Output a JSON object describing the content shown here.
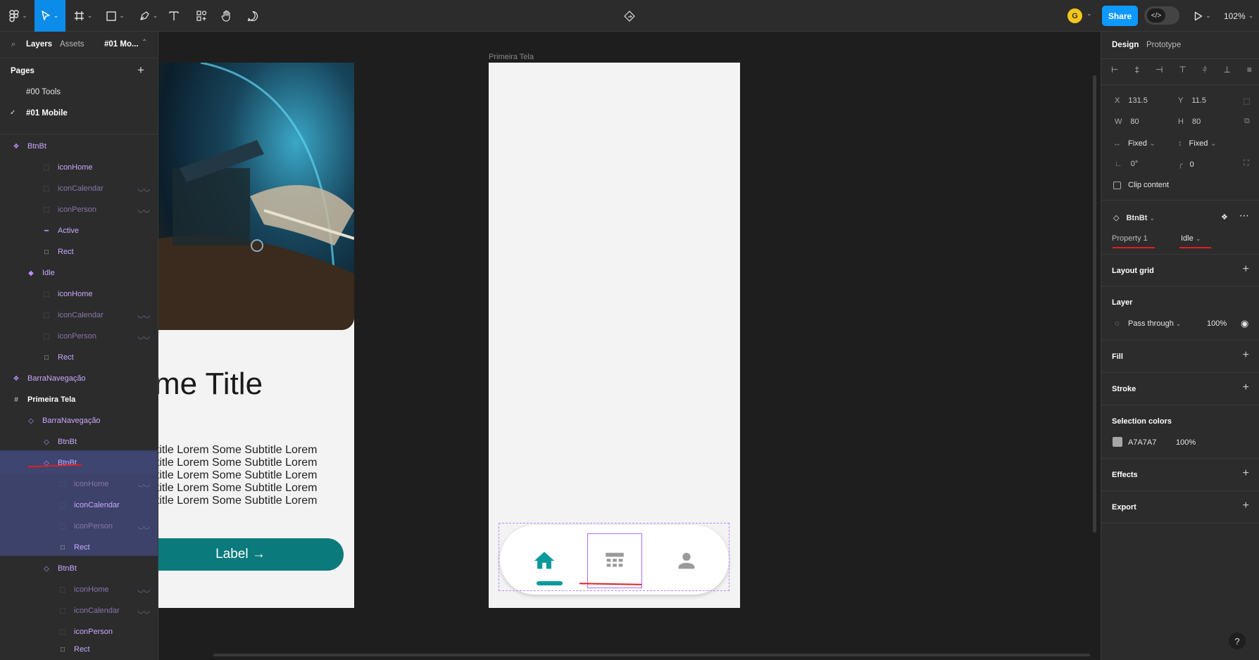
{
  "toolbar": {
    "tools": [
      "figma-menu",
      "move-tool",
      "frame-tool",
      "shape-tool",
      "pen-tool",
      "text-tool",
      "resources-tool",
      "hand-tool",
      "comment-tool"
    ],
    "share_label": "Share",
    "avatar_initial": "G",
    "zoom": "102%"
  },
  "left_panel": {
    "tabs": [
      "Layers",
      "Assets"
    ],
    "page_switcher": "#01 Mo...",
    "pages_heading": "Pages",
    "pages": [
      "#00 Tools",
      "#01 Mobile"
    ],
    "current_page": "#01 Mobile",
    "layers": [
      {
        "name": "BtnBt"
      },
      {
        "name": "iconHome"
      },
      {
        "name": "iconCalendar"
      },
      {
        "name": "iconPerson"
      },
      {
        "name": "Active"
      },
      {
        "name": "Rect"
      },
      {
        "name": "Idle"
      },
      {
        "name": "iconHome"
      },
      {
        "name": "iconCalendar"
      },
      {
        "name": "iconPerson"
      },
      {
        "name": "Rect"
      },
      {
        "name": "BarraNavegação"
      },
      {
        "name": "Primeira Tela"
      },
      {
        "name": "BarraNavegação"
      },
      {
        "name": "BtnBt"
      },
      {
        "name": "BtnBt"
      },
      {
        "name": "iconHome"
      },
      {
        "name": "iconCalendar"
      },
      {
        "name": "iconPerson"
      },
      {
        "name": "Rect"
      },
      {
        "name": "BtnBt"
      },
      {
        "name": "iconHome"
      },
      {
        "name": "iconCalendar"
      },
      {
        "name": "iconPerson"
      },
      {
        "name": "Rect"
      }
    ]
  },
  "canvas": {
    "left_frame": {
      "title": "me Title",
      "subtitle_lines": [
        "btitle Lorem Some Subtitle Lorem",
        "btitle Lorem Some Subtitle Lorem",
        "btitle Lorem Some Subtitle Lorem",
        "btitle Lorem Some Subtitle Lorem",
        "btitle Lorem Some Subtitle Lorem"
      ],
      "button_label": "Label →"
    },
    "main_frame": {
      "label": "Primeira Tela",
      "nav_buttons": [
        "home-icon",
        "calendar-icon",
        "person-icon"
      ]
    }
  },
  "right_panel": {
    "tabs": [
      "Design",
      "Prototype"
    ],
    "x_label": "X",
    "x_value": "131.5",
    "y_label": "Y",
    "y_value": "11.5",
    "w_label": "W",
    "w_value": "80",
    "h_label": "H",
    "h_value": "80",
    "h_constraint": "Fixed",
    "v_constraint": "Fixed",
    "rotation": "0°",
    "radius": "0",
    "clip_content": "Clip content",
    "component_name": "BtnBt",
    "property_name": "Property 1",
    "property_value": "Idle",
    "layout_grid": "Layout grid",
    "layer_heading": "Layer",
    "blend_mode": "Pass through",
    "opacity": "100%",
    "fill": "Fill",
    "stroke": "Stroke",
    "selection_colors": "Selection colors",
    "sel_color_hex": "A7A7A7",
    "sel_color_opacity": "100%",
    "effects": "Effects",
    "export": "Export",
    "help": "?"
  },
  "colors": {
    "accent": "#0c8ce9",
    "component_purple": "#c9a9ff",
    "teal": "#0a9a9c",
    "selection_swatch": "#a7a7a7"
  }
}
